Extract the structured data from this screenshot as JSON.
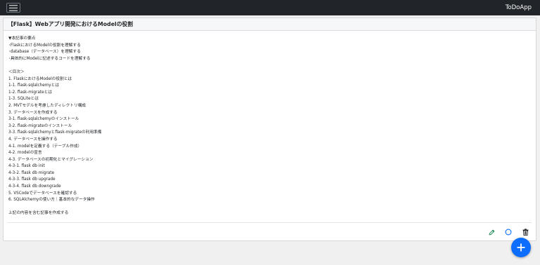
{
  "navbar": {
    "brand": "ToDoApp",
    "menu_icon": "hamburger-icon"
  },
  "card": {
    "title": "【Flask】Webアプリ開発におけるModelの役割",
    "lines": [
      "▼本記事の要点",
      "･FlaskにおけるModelの役割を理解する",
      "･database（データベース）を理解する",
      "･具体的にModelに記述するコードを理解する",
      "",
      "＜目次＞",
      "1. FlaskにおけるModelの役割とは",
      "1-1. flask-sqlalchemyとは",
      "1-2. flask-migrateとは",
      "1-3. SQLiteとは",
      "2. MVTモデルを考慮したディレクトリ構成",
      "3. データベースを作成する",
      "3-1. flask-sqlalchemyのインストール",
      "3-2. flask-migrateのインストール",
      "3-3. flask-sqlalchemyとflask-migrateの利用準備",
      "4. データベースを操作する",
      "4-1. modelを定義する（テーブル作成）",
      "4-2. modelの宣言",
      "4-3. データベースの初期化とマイグレーション",
      "4-3-1. flask db init",
      "4-3-2. flask db migrate",
      "4-3-3. flask db upgrade",
      "4-3-4. flask db downgrade",
      "5. VSCodeでデータベースを確認する",
      "6. SQLAlchemyの使い方｜基本的なデータ操作",
      "",
      "上記の内容を含む記事を作成する"
    ],
    "actions": {
      "edit_icon": "pencil-icon",
      "complete_icon": "circle-icon",
      "delete_icon": "trash-icon"
    }
  },
  "fab": {
    "icon": "plus-icon",
    "color": "#0d6efd"
  }
}
